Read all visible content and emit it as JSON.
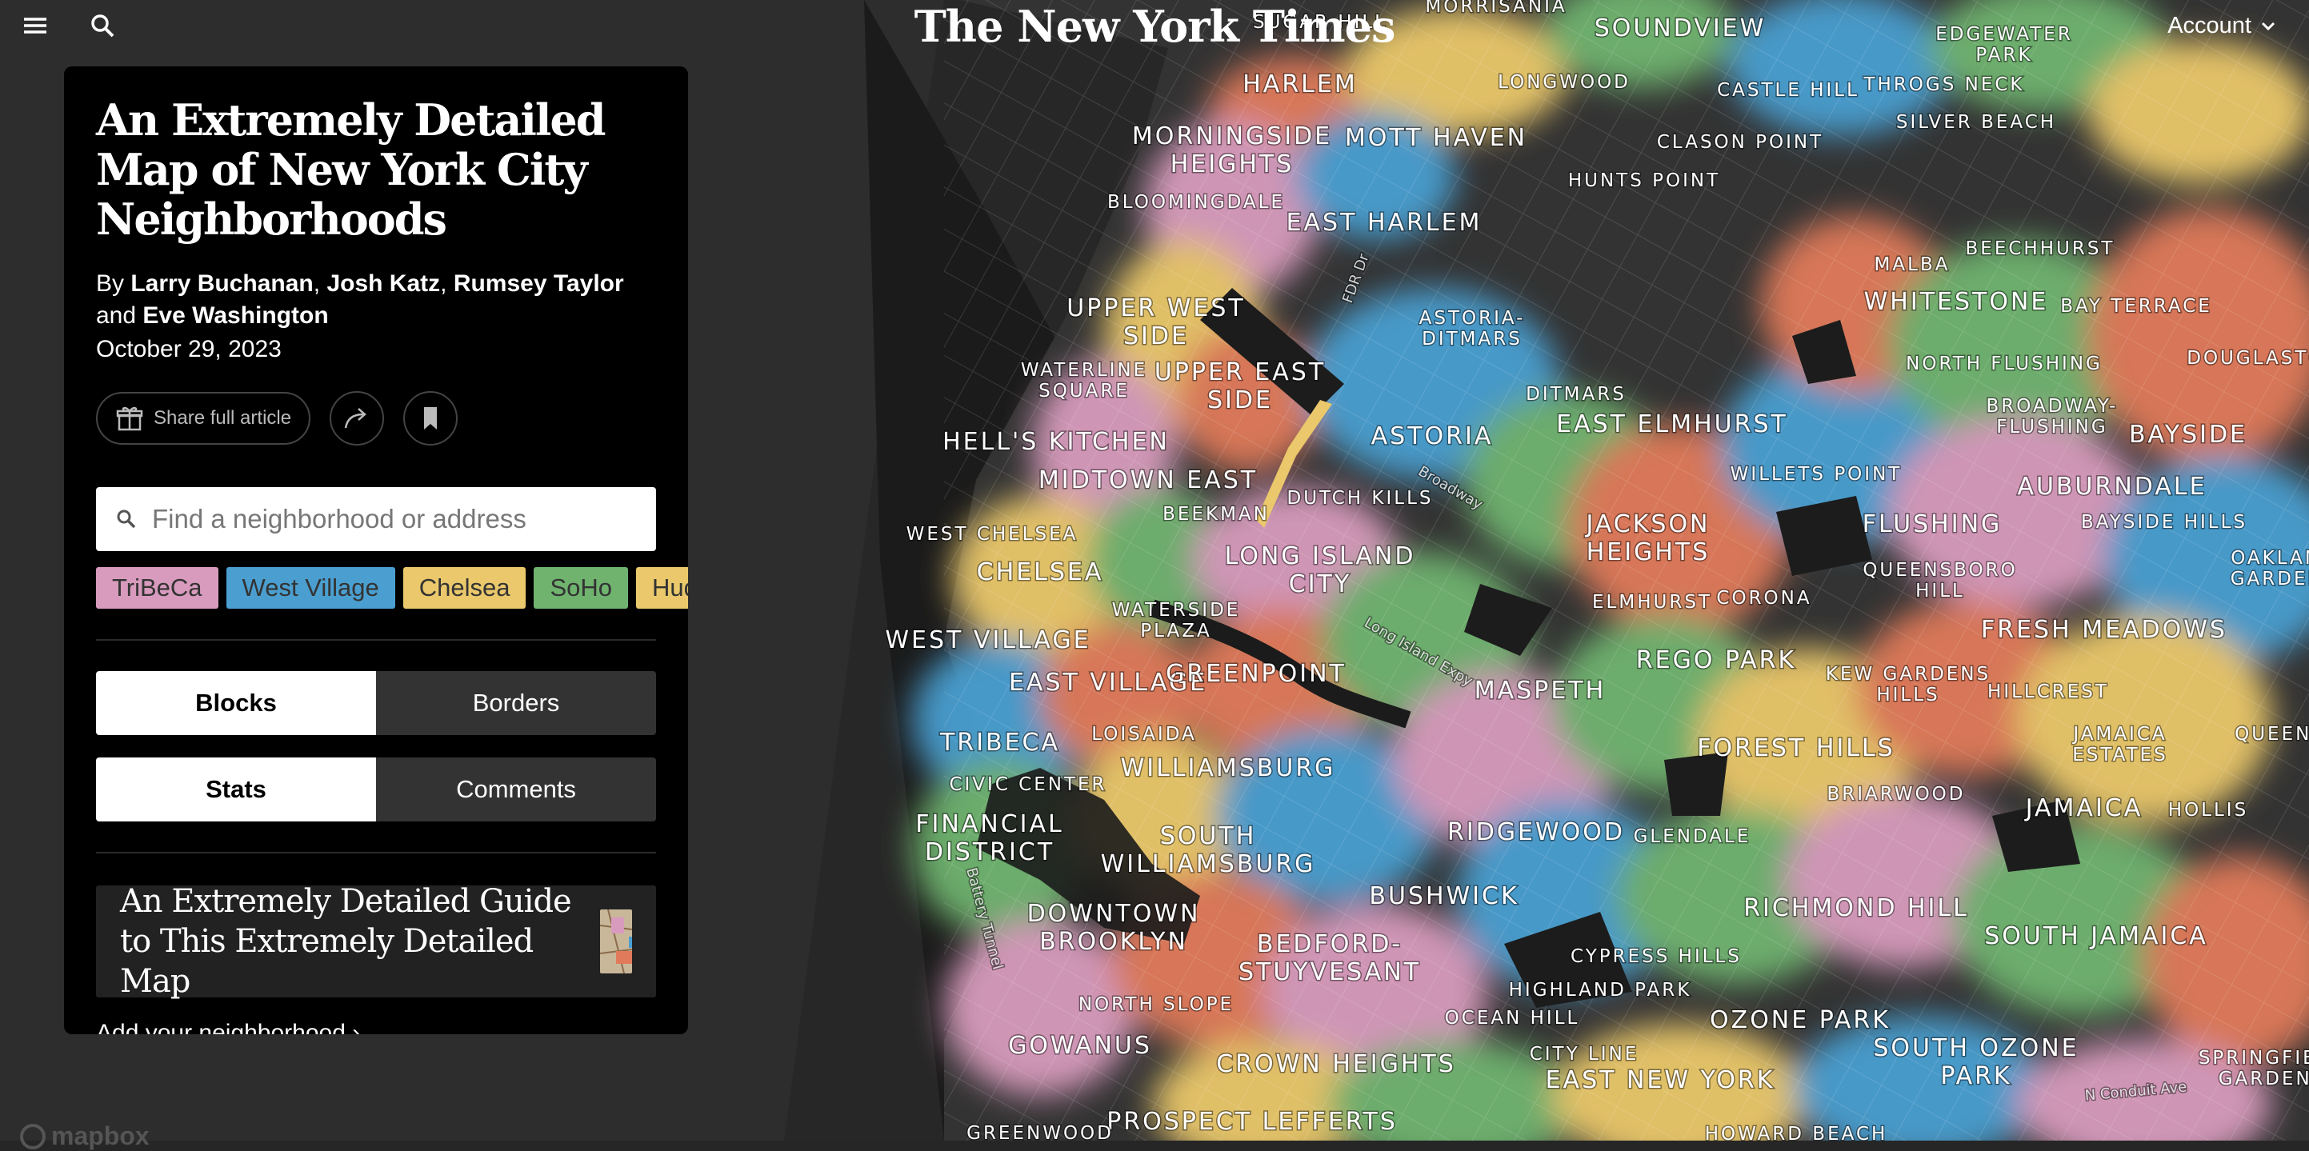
{
  "masthead": "The New York Times",
  "account_label": "Account",
  "article": {
    "headline": "An Extremely Detailed Map of New York City Neighborhoods",
    "by": "By",
    "authors": [
      "Larry Buchanan",
      "Josh Katz",
      "Rumsey Taylor",
      "Eve Washington"
    ],
    "and": "and",
    "date": "October 29, 2023"
  },
  "share_label": "Share full article",
  "search": {
    "placeholder": "Find a neighborhood or address"
  },
  "chips": [
    {
      "label": "TriBeCa",
      "color": "#d89bbd"
    },
    {
      "label": "West Village",
      "color": "#4a9fd0"
    },
    {
      "label": "Chelsea",
      "color": "#eac86b"
    },
    {
      "label": "SoHo",
      "color": "#6fb36f"
    },
    {
      "label": "Hudson Yards",
      "color": "#eac86b"
    }
  ],
  "view_toggle": {
    "blocks": "Blocks",
    "borders": "Borders"
  },
  "panel_toggle": {
    "stats": "Stats",
    "comments": "Comments"
  },
  "guide": {
    "title": "An Extremely Detailed Guide to This Extremely Detailed Map"
  },
  "add_link": "Add your neighborhood ›",
  "map_labels": [
    "HARLEM",
    "MORNINGSIDE HEIGHTS",
    "BLOOMINGDALE",
    "EAST HARLEM",
    "MOTT HAVEN",
    "UPPER WEST SIDE",
    "UPPER EAST SIDE",
    "WATERLINE SQUARE",
    "HELL'S KITCHEN",
    "MIDTOWN EAST",
    "WEST CHELSEA",
    "CHELSEA",
    "BEEKMAN",
    "DUTCH KILLS",
    "LONG ISLAND CITY",
    "ASTORIA",
    "ASTORIA-DITMARS",
    "DITMARS",
    "EAST ELMHURST",
    "JACKSON HEIGHTS",
    "WATERSIDE PLAZA",
    "WEST VILLAGE",
    "EAST VILLAGE",
    "GREENPOINT",
    "TRIBECA",
    "CIVIC CENTER",
    "FINANCIAL DISTRICT",
    "LOISAIDA",
    "WILLIAMSBURG",
    "SOUTH WILLIAMSBURG",
    "DOWNTOWN BROOKLYN",
    "BUSHWICK",
    "BEDFORD-STUYVESANT",
    "NORTH SLOPE",
    "GOWANUS",
    "CROWN HEIGHTS",
    "PROSPECT LEFFERTS",
    "GREENWOOD",
    "MASPETH",
    "RIDGEWOOD",
    "GLENDALE",
    "ELMHURST",
    "CORONA",
    "REGO PARK",
    "FOREST HILLS",
    "KEW GARDENS HILLS",
    "FLUSHING",
    "QUEENSBORO HILL",
    "FRESH MEADOWS",
    "HILLCREST",
    "JAMAICA ESTATES",
    "JAMAICA",
    "HOLLIS",
    "BRIARWOOD",
    "RICHMOND HILL",
    "SOUTH JAMAICA",
    "CYPRESS HILLS",
    "HIGHLAND PARK",
    "OCEAN HILL",
    "CITY LINE",
    "EAST NEW YORK",
    "OZONE PARK",
    "SOUTH OZONE PARK",
    "HOWARD BEACH",
    "SOUNDVIEW",
    "CASTLE HILL",
    "THROGS NECK",
    "EDGEWATER PARK",
    "SILVER BEACH",
    "LONGWOOD",
    "CLASON POINT",
    "HUNTS POINT",
    "MALBA",
    "BEECHHURST",
    "WHITESTONE",
    "BAY TERRACE",
    "NORTH FLUSHING",
    "BROADWAY-FLUSHING",
    "DOUGLASTON",
    "BAYSIDE",
    "AUBURNDALE",
    "BAYSIDE HILLS",
    "OAKLAND GARDENS",
    "WILLETS POINT",
    "SPRINGFIELD GARDENS",
    "QUEENS",
    "MORRISANIA",
    "SUGAR HILL",
    "Broadway",
    "Long Island Expy",
    "FDR Dr",
    "Battery Tunnel",
    "N Conduit Ave"
  ],
  "attribution": "mapbox"
}
